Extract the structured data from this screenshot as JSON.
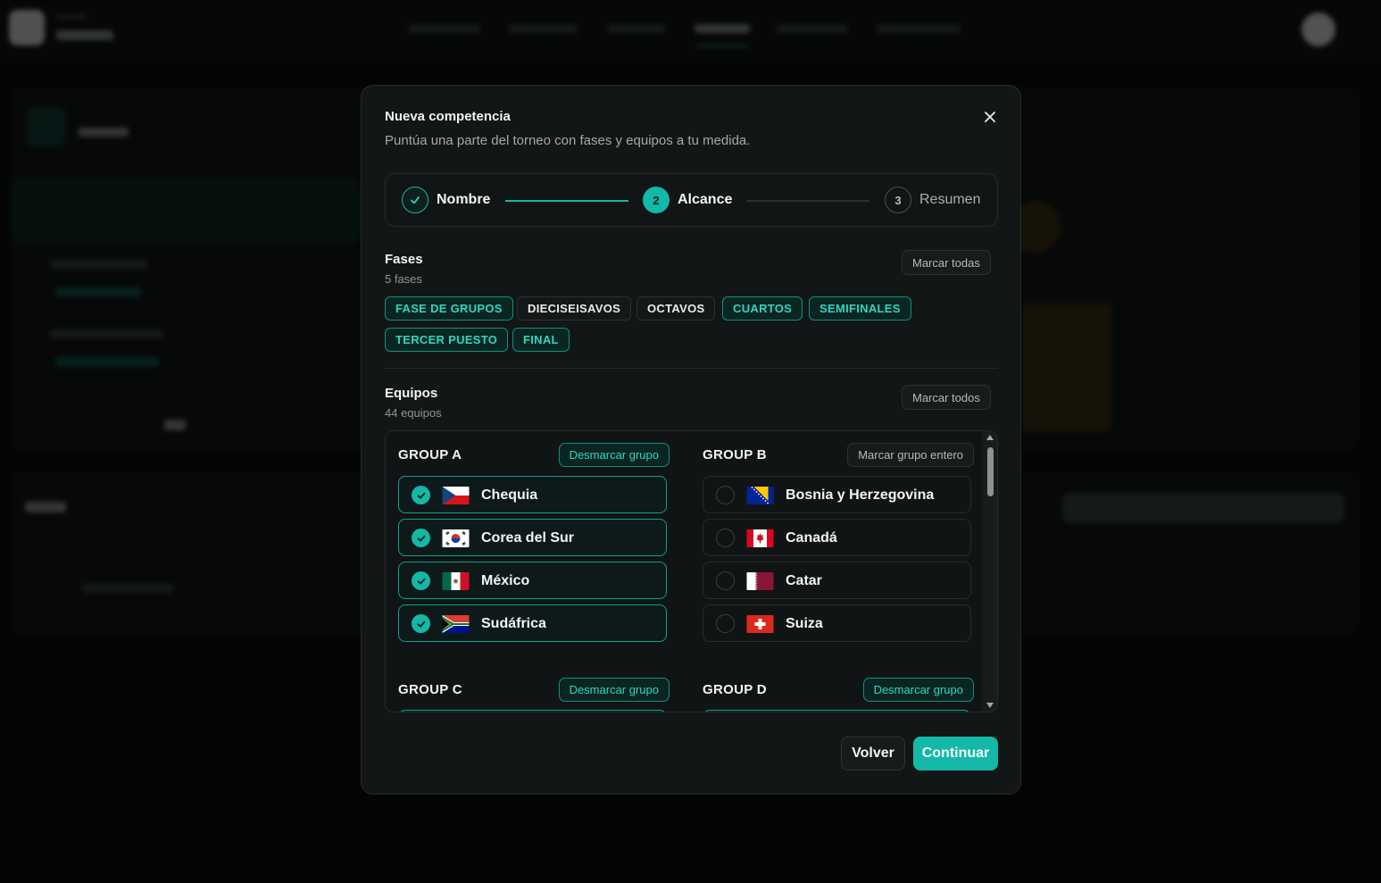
{
  "modal": {
    "title": "Nueva competencia",
    "subtitle": "Puntúa una parte del torneo con fases y equipos a tu medida."
  },
  "stepper": {
    "steps": [
      {
        "label": "Nombre",
        "status": "done",
        "number": "1"
      },
      {
        "label": "Alcance",
        "status": "active",
        "number": "2"
      },
      {
        "label": "Resumen",
        "status": "todo",
        "number": "3"
      }
    ]
  },
  "phases": {
    "title": "Fases",
    "count": "5 fases",
    "mark_all": "Marcar todas",
    "items": [
      {
        "label": "FASE DE GRUPOS",
        "selected": true
      },
      {
        "label": "DIECISEISAVOS",
        "selected": false
      },
      {
        "label": "OCTAVOS",
        "selected": false
      },
      {
        "label": "CUARTOS",
        "selected": true
      },
      {
        "label": "SEMIFINALES",
        "selected": true
      },
      {
        "label": "TERCER PUESTO",
        "selected": true
      },
      {
        "label": "FINAL",
        "selected": true
      }
    ]
  },
  "teams": {
    "title": "Equipos",
    "count": "44 equipos",
    "mark_all": "Marcar todos",
    "groups": [
      {
        "name": "GROUP A",
        "action": "Desmarcar grupo",
        "teams": [
          {
            "name": "Chequia",
            "flag": "czech-flag",
            "selected": true
          },
          {
            "name": "Corea del Sur",
            "flag": "south-korea-flag",
            "selected": true
          },
          {
            "name": "México",
            "flag": "mexico-flag",
            "selected": true
          },
          {
            "name": "Sudáfrica",
            "flag": "south-africa-flag",
            "selected": true
          }
        ]
      },
      {
        "name": "GROUP B",
        "action": "Marcar grupo entero",
        "teams": [
          {
            "name": "Bosnia y Herzegovina",
            "flag": "bosnia-flag",
            "selected": false
          },
          {
            "name": "Canadá",
            "flag": "canada-flag",
            "selected": false
          },
          {
            "name": "Catar",
            "flag": "qatar-flag",
            "selected": false
          },
          {
            "name": "Suiza",
            "flag": "switzerland-flag",
            "selected": false
          }
        ]
      },
      {
        "name": "GROUP C",
        "action": "Desmarcar grupo"
      },
      {
        "name": "GROUP D",
        "action": "Desmarcar grupo"
      }
    ]
  },
  "footer": {
    "back": "Volver",
    "next": "Continuar"
  },
  "colors": {
    "accent": "#14b8a6",
    "accent_text": "#2fd5c0",
    "modal_bg": "#131616"
  }
}
